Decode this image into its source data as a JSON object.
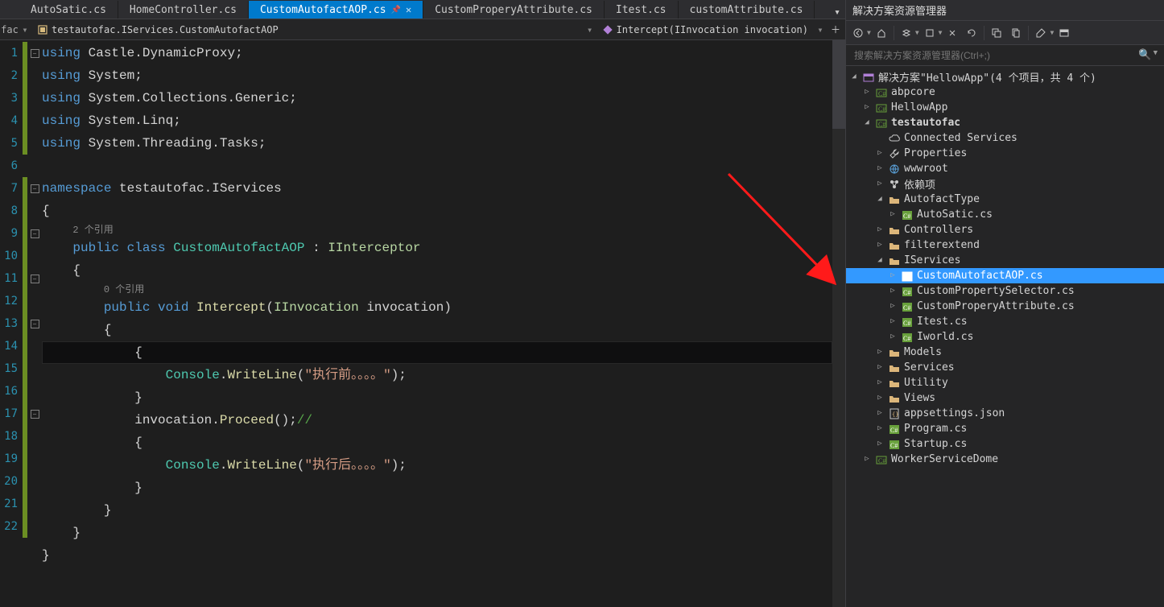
{
  "tabs": [
    {
      "label": "AutoSatic.cs",
      "active": false
    },
    {
      "label": "HomeController.cs",
      "active": false
    },
    {
      "label": "CustomAutofactAOP.cs",
      "active": true,
      "pinned": true
    },
    {
      "label": "CustomProperyAttribute.cs",
      "active": false
    },
    {
      "label": "Itest.cs",
      "active": false
    },
    {
      "label": "customAttribute.cs",
      "active": false
    }
  ],
  "breadcrumb": {
    "left": "fac",
    "mid": "testautofac.IServices.CustomAutofactAOP",
    "right": "Intercept(IInvocation invocation)"
  },
  "code": {
    "lines": [
      1,
      2,
      3,
      4,
      5,
      6,
      7,
      8,
      9,
      10,
      11,
      12,
      13,
      14,
      15,
      16,
      17,
      18,
      19,
      20,
      21,
      22
    ],
    "codelens1": "2 个引用",
    "codelens2": "0 个引用",
    "kw_using": "using",
    "ns_castle": "Castle.DynamicProxy",
    "ns_system": "System",
    "ns_generic": "System.Collections.Generic",
    "ns_linq": "System.Linq",
    "ns_tasks": "System.Threading.Tasks",
    "kw_namespace": "namespace",
    "ns_self": "testautofac.IServices",
    "kw_public": "public",
    "kw_class": "class",
    "cls": "CustomAutofactAOP",
    "iface": "IInterceptor",
    "kw_void": "void",
    "mth_intercept": "Intercept",
    "t_iinv": "IInvocation",
    "p_inv": "invocation",
    "t_console": "Console",
    "mth_wl": "WriteLine",
    "str_before": "\"执行前。。。。\"",
    "str_after": "\"执行后。。。。\"",
    "mth_proceed": "Proceed",
    "comment": "//"
  },
  "explorer": {
    "title": "解决方案资源管理器",
    "search_placeholder": "搜索解决方案资源管理器(Ctrl+;)",
    "root": "解决方案\"HellowApp\"(4 个项目，共 4 个)",
    "nodes": [
      {
        "d": 1,
        "tw": "r",
        "ic": "proj",
        "t": "abpcore"
      },
      {
        "d": 1,
        "tw": "r",
        "ic": "proj",
        "t": "HellowApp"
      },
      {
        "d": 1,
        "tw": "d",
        "ic": "proj",
        "t": "testautofac",
        "bold": true
      },
      {
        "d": 2,
        "tw": "n",
        "ic": "cloud",
        "t": "Connected Services"
      },
      {
        "d": 2,
        "tw": "r",
        "ic": "wrench",
        "t": "Properties"
      },
      {
        "d": 2,
        "tw": "r",
        "ic": "globe",
        "t": "wwwroot"
      },
      {
        "d": 2,
        "tw": "r",
        "ic": "dep",
        "t": "依赖项"
      },
      {
        "d": 2,
        "tw": "d",
        "ic": "folder",
        "t": "AutofactType"
      },
      {
        "d": 3,
        "tw": "r",
        "ic": "cs",
        "t": "AutoSatic.cs"
      },
      {
        "d": 2,
        "tw": "r",
        "ic": "folder",
        "t": "Controllers"
      },
      {
        "d": 2,
        "tw": "r",
        "ic": "folder",
        "t": "filterextend"
      },
      {
        "d": 2,
        "tw": "d",
        "ic": "folder",
        "t": "IServices"
      },
      {
        "d": 3,
        "tw": "r",
        "ic": "cs",
        "t": "CustomAutofactAOP.cs",
        "sel": true
      },
      {
        "d": 3,
        "tw": "r",
        "ic": "cs",
        "t": "CustomPropertySelector.cs"
      },
      {
        "d": 3,
        "tw": "r",
        "ic": "cs",
        "t": "CustomProperyAttribute.cs"
      },
      {
        "d": 3,
        "tw": "r",
        "ic": "cs",
        "t": "Itest.cs"
      },
      {
        "d": 3,
        "tw": "r",
        "ic": "cs",
        "t": "Iworld.cs"
      },
      {
        "d": 2,
        "tw": "r",
        "ic": "folder",
        "t": "Models"
      },
      {
        "d": 2,
        "tw": "r",
        "ic": "folder",
        "t": "Services"
      },
      {
        "d": 2,
        "tw": "r",
        "ic": "folder",
        "t": "Utility"
      },
      {
        "d": 2,
        "tw": "r",
        "ic": "folder",
        "t": "Views"
      },
      {
        "d": 2,
        "tw": "r",
        "ic": "json",
        "t": "appsettings.json"
      },
      {
        "d": 2,
        "tw": "r",
        "ic": "cs",
        "t": "Program.cs"
      },
      {
        "d": 2,
        "tw": "r",
        "ic": "cs",
        "t": "Startup.cs"
      },
      {
        "d": 1,
        "tw": "r",
        "ic": "proj",
        "t": "WorkerServiceDome"
      }
    ]
  }
}
